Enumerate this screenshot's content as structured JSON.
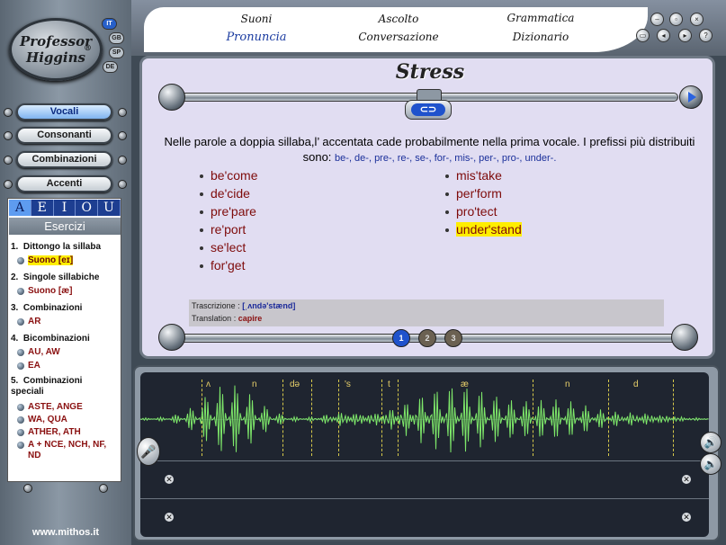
{
  "app": {
    "logo_line1": "Professor",
    "logo_line2": "Higgins",
    "logo_mark": "®",
    "website": "www.mithos.it"
  },
  "languages": [
    {
      "code": "IT",
      "selected": true
    },
    {
      "code": "GB",
      "selected": false
    },
    {
      "code": "SP",
      "selected": false
    },
    {
      "code": "DE",
      "selected": false
    }
  ],
  "categories": [
    {
      "label": "Vocali",
      "active": true
    },
    {
      "label": "Consonanti",
      "active": false
    },
    {
      "label": "Combinazioni",
      "active": false
    },
    {
      "label": "Accenti",
      "active": false
    }
  ],
  "vowel_tabs": [
    "A",
    "E",
    "I",
    "O",
    "U"
  ],
  "selected_vowel": "A",
  "exercises_title": "Esercizi",
  "exercises": [
    {
      "num": "1.",
      "title": "Dittongo la sillaba",
      "items": [
        "Suono [eɪ]"
      ],
      "highlighted": "Suono [eɪ]"
    },
    {
      "num": "2.",
      "title": "Singole sillabiche",
      "items": [
        "Suono [æ]"
      ]
    },
    {
      "num": "3.",
      "title": "Combinazioni",
      "items": [
        "AR"
      ]
    },
    {
      "num": "4.",
      "title": "Bicombinazioni",
      "items": [
        "AU, AW",
        "EA"
      ]
    },
    {
      "num": "5.",
      "title": "Combinazioni speciali",
      "items": [
        "ASTE, ANGE",
        "WA, QUA",
        "ATHER, ATH",
        "A + NCE, NCH, NF, ND"
      ]
    }
  ],
  "top_menu": {
    "row1": [
      "Suoni",
      "Ascolto",
      "Grammatica"
    ],
    "row2": [
      "Pronuncia",
      "Conversazione",
      "Dizionario"
    ],
    "selected": "Pronuncia"
  },
  "window_controls": [
    "minimize-icon",
    "restore-icon",
    "close-icon"
  ],
  "tool_controls": [
    "print-icon",
    "back-icon",
    "forward-icon",
    "help-icon"
  ],
  "lesson": {
    "title": "Stress",
    "instruction_main": "Nelle parole a doppia sillaba,l’ accentata cade probabilmente nella prima vocale. I prefissi più distribuiti sono:",
    "instruction_prefixes": "be-, de-, pre-, re-, se-, for-, mis-, per-, pro-, under-.",
    "words_left": [
      "be'come",
      "de'cide",
      "pre'pare",
      "re'port",
      "se'lect",
      "for'get"
    ],
    "words_right": [
      "mis'take",
      "per'form",
      "pro'tect",
      "under'stand"
    ],
    "highlighted_word": "under'stand",
    "transcription_label": "Trascrizione :",
    "transcription_value": "[ˌʌndə'stænd]",
    "translation_label": "Translation :",
    "translation_value": "capire",
    "repeat_label": "⊂⊃",
    "step_buttons": [
      "1",
      "2",
      "3"
    ],
    "active_step": "1"
  },
  "waveform": {
    "phonemes": [
      "ʌ",
      "n",
      "də",
      "'s",
      "t",
      "æ",
      "n",
      "d"
    ]
  }
}
